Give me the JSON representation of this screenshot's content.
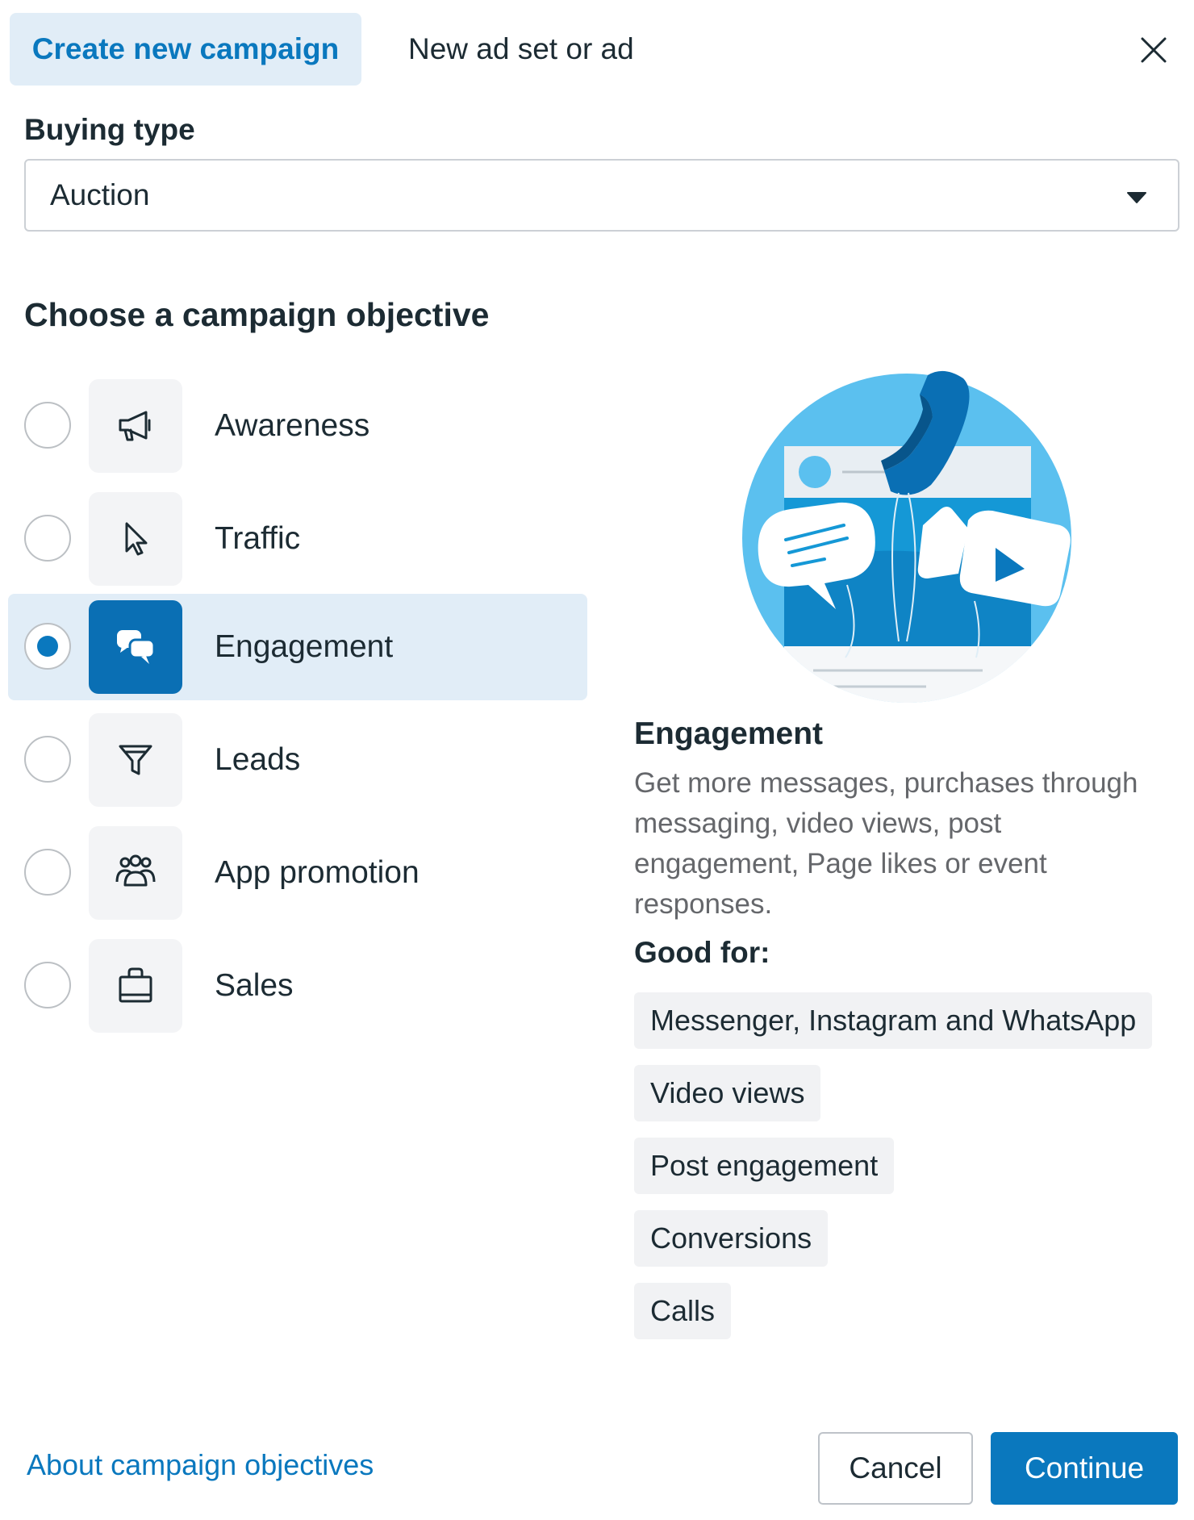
{
  "header": {
    "tabs": [
      {
        "label": "Create new campaign",
        "active": true
      },
      {
        "label": "New ad set or ad",
        "active": false
      }
    ],
    "close_icon": "close-icon"
  },
  "buying_type": {
    "label": "Buying type",
    "selected": "Auction"
  },
  "objectives": {
    "title": "Choose a campaign objective",
    "items": [
      {
        "label": "Awareness",
        "icon": "megaphone-icon",
        "selected": false
      },
      {
        "label": "Traffic",
        "icon": "cursor-icon",
        "selected": false
      },
      {
        "label": "Engagement",
        "icon": "chat-bubbles-icon",
        "selected": true
      },
      {
        "label": "Leads",
        "icon": "funnel-icon",
        "selected": false
      },
      {
        "label": "App promotion",
        "icon": "people-icon",
        "selected": false
      },
      {
        "label": "Sales",
        "icon": "shopping-bag-icon",
        "selected": false
      }
    ]
  },
  "detail": {
    "title": "Engagement",
    "description": "Get more messages, purchases through messaging, video views, post engagement, Page likes or event responses.",
    "good_for_label": "Good for:",
    "good_for": [
      "Messenger, Instagram and WhatsApp",
      "Video views",
      "Post engagement",
      "Conversions",
      "Calls"
    ]
  },
  "footer": {
    "about_link": "About campaign objectives",
    "cancel": "Cancel",
    "continue": "Continue"
  },
  "colors": {
    "accent": "#0a78be",
    "selected_bg": "#e1edf7",
    "illustration_sky": "#5bc0ef",
    "illustration_dark": "#0a6fb4"
  }
}
